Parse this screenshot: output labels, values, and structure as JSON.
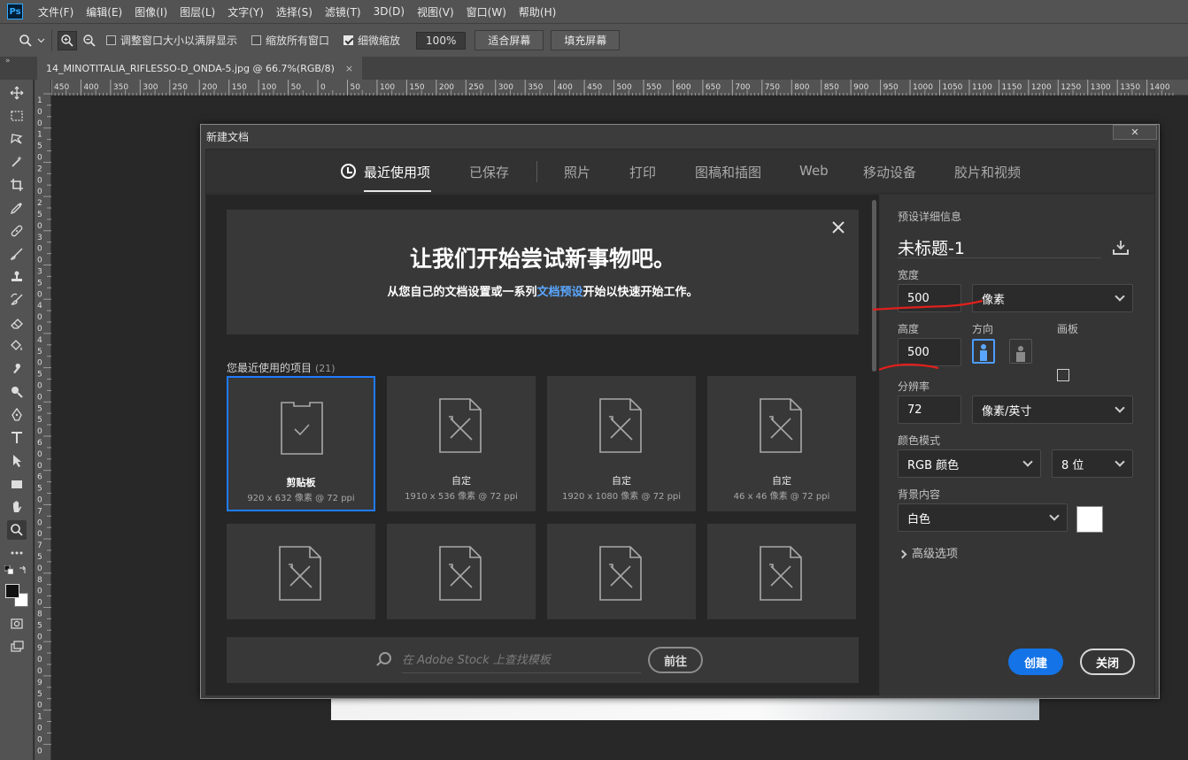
{
  "app": {
    "logo": "Ps"
  },
  "menu": [
    "文件(F)",
    "编辑(E)",
    "图像(I)",
    "图层(L)",
    "文字(Y)",
    "选择(S)",
    "滤镜(T)",
    "3D(D)",
    "视图(V)",
    "窗口(W)",
    "帮助(H)"
  ],
  "options": {
    "resize_windows": "调整窗口大小以满屏显示",
    "zoom_all": "缩放所有窗口",
    "scrubby_zoom": "细微缩放",
    "zoom_value": "100%",
    "fit_screen": "适合屏幕",
    "fill_screen": "填充屏幕"
  },
  "document_tab": {
    "title": "14_MINOTITALIA_RIFLESSO-D_ONDA-5.jpg @ 66.7%(RGB/8)",
    "close": "×"
  },
  "rulers": {
    "h_labels": [
      "450",
      "400",
      "350",
      "300",
      "250",
      "200",
      "150",
      "100",
      "50",
      "0",
      "50",
      "100",
      "150",
      "200",
      "250",
      "300",
      "350",
      "400",
      "450",
      "500",
      "550",
      "600",
      "650",
      "700",
      "750",
      "800",
      "850",
      "900",
      "950",
      "1000",
      "1050",
      "1100",
      "1150",
      "1200",
      "1250",
      "1300",
      "1350",
      "1400"
    ],
    "v_labels": [
      "1",
      "0",
      "0",
      "1",
      "5",
      "0",
      "2",
      "0",
      "0",
      "2",
      "5",
      "0",
      "3",
      "0",
      "0",
      "3",
      "5",
      "0",
      "4",
      "0",
      "0",
      "4",
      "5",
      "0",
      "5",
      "0",
      "0",
      "5",
      "5",
      "0",
      "6",
      "0",
      "0",
      "6",
      "5",
      "0",
      "7",
      "0",
      "0",
      "7",
      "5",
      "0",
      "8",
      "0",
      "0",
      "8",
      "5",
      "0",
      "9",
      "0",
      "0",
      "9",
      "5",
      "0",
      "1",
      "0",
      "0",
      "0"
    ]
  },
  "dialog": {
    "title": "新建文档",
    "close_glyph": "✕",
    "tabs": [
      "最近使用项",
      "已保存",
      "照片",
      "打印",
      "图稿和插图",
      "Web",
      "移动设备",
      "胶片和视频"
    ],
    "welcome": {
      "title": "让我们开始尝试新事物吧。",
      "sub_before": "从您自己的文档设置或一系列",
      "sub_link": "文档预设",
      "sub_after": "开始以快速开始工作。"
    },
    "recent": {
      "label": "您最近使用的项目",
      "count": "(21)"
    },
    "cards": [
      {
        "name": "剪贴板",
        "dims": "920 x 632 像素 @ 72 ppi"
      },
      {
        "name": "自定",
        "dims": "1910 x 536 像素 @ 72 ppi"
      },
      {
        "name": "自定",
        "dims": "1920 x 1080 像素 @ 72 ppi"
      },
      {
        "name": "自定",
        "dims": "46 x 46 像素 @ 72 ppi"
      }
    ],
    "stock": {
      "placeholder": "在 Adobe Stock 上查找模板",
      "go": "前往"
    },
    "details": {
      "header": "预设详细信息",
      "name": "未标题-1",
      "width_label": "宽度",
      "width_value": "500",
      "width_unit": "像素",
      "height_label": "高度",
      "height_value": "500",
      "orientation_label": "方向",
      "artboard_label": "画板",
      "resolution_label": "分辨率",
      "resolution_value": "72",
      "resolution_unit": "像素/英寸",
      "color_mode_label": "颜色模式",
      "color_mode_value": "RGB 颜色",
      "bit_depth": "8 位",
      "bg_label": "背景内容",
      "bg_value": "白色",
      "advanced": "高级选项",
      "create": "创建",
      "close": "关闭"
    }
  },
  "colors": {
    "accent": "#1473e6",
    "link": "#5aa7ff",
    "annotation": "#e0201c"
  }
}
